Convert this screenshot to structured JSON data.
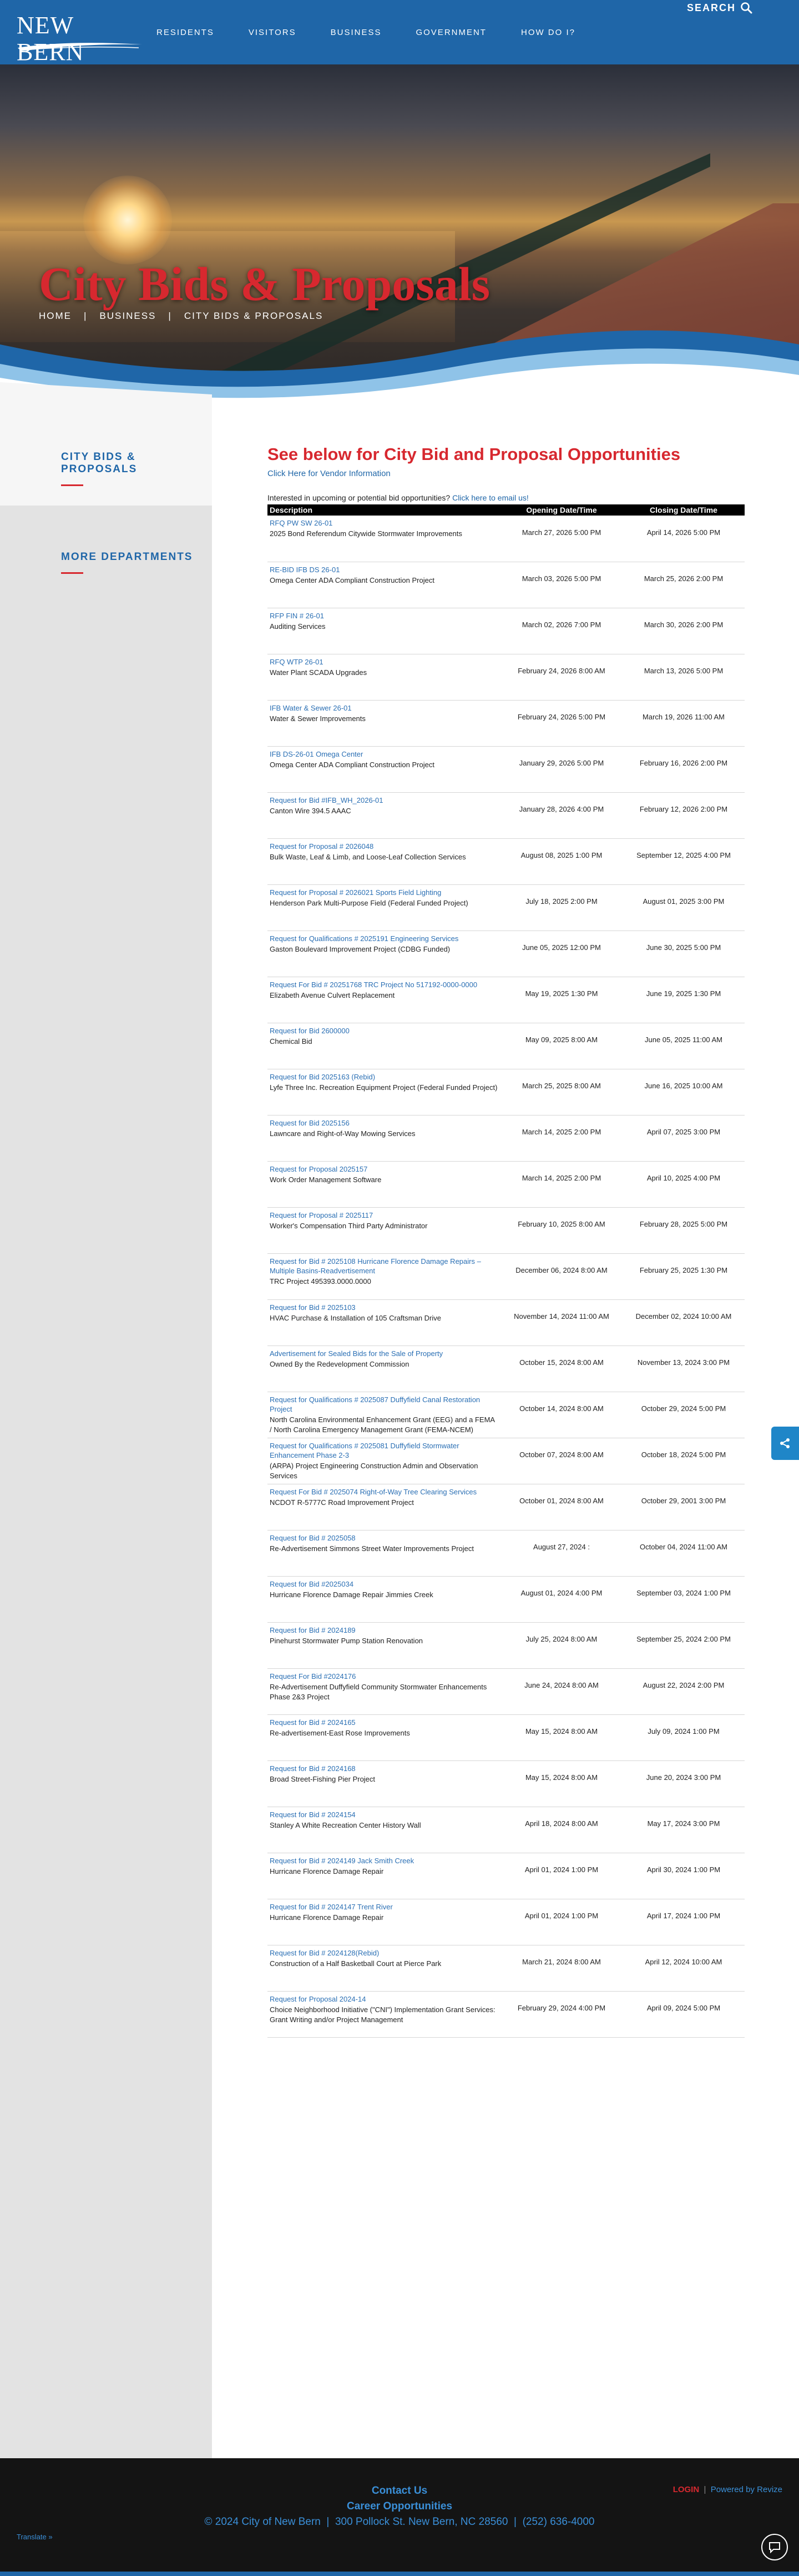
{
  "header": {
    "logo_text": "NEW BERN",
    "nav": [
      "RESIDENTS",
      "VISITORS",
      "BUSINESS",
      "GOVERNMENT",
      "HOW DO I?"
    ],
    "search_label": "SEARCH"
  },
  "hero": {
    "title": "City Bids & Proposals",
    "breadcrumb": [
      "HOME",
      "BUSINESS",
      "CITY BIDS & PROPOSALS"
    ]
  },
  "sidebar": {
    "current": "CITY BIDS & PROPOSALS",
    "more": "MORE DEPARTMENTS"
  },
  "main": {
    "heading": "See below for City Bid and Proposal Opportunities",
    "vendor_link": "Click Here for Vendor Information",
    "interest_text": "Interested in upcoming or potential bid opportunities?",
    "interest_link": "Click here to email us!",
    "columns": [
      "Description",
      "Opening Date/Time",
      "Closing Date/Time"
    ],
    "bids": [
      {
        "link": "RFQ PW SW 26-01",
        "desc": "2025 Bond Referendum Citywide Stormwater Improvements",
        "open": "March 27, 2026 5:00 PM",
        "close": "April 14, 2026 5:00 PM"
      },
      {
        "link": "RE-BID IFB DS 26-01",
        "desc": "Omega Center ADA Compliant Construction Project",
        "open": "March 03, 2026 5:00 PM",
        "close": "March 25, 2026 2:00 PM"
      },
      {
        "link": "RFP FIN # 26-01",
        "desc": "Auditing Services",
        "open": "March 02, 2026 7:00 PM",
        "close": "March 30, 2026 2:00 PM"
      },
      {
        "link": "RFQ WTP 26-01",
        "desc": "Water Plant SCADA Upgrades",
        "open": "February 24, 2026 8:00 AM",
        "close": "March 13, 2026 5:00 PM"
      },
      {
        "link": "IFB Water & Sewer 26-01",
        "desc": "Water & Sewer Improvements",
        "open": "February 24, 2026 5:00 PM",
        "close": "March 19, 2026 11:00 AM"
      },
      {
        "link": "IFB DS-26-01 Omega Center",
        "desc": "Omega Center ADA Compliant Construction Project",
        "open": "January 29, 2026 5:00 PM",
        "close": "February 16, 2026 2:00 PM"
      },
      {
        "link": "Request for Bid #IFB_WH_2026-01",
        "desc": "Canton Wire 394.5 AAAC",
        "open": "January 28, 2026 4:00 PM",
        "close": "February 12, 2026 2:00 PM"
      },
      {
        "link": "Request for Proposal  # 2026048",
        "desc": "Bulk Waste, Leaf & Limb, and Loose-Leaf Collection Services",
        "open": "August 08, 2025 1:00 PM",
        "close": "September 12, 2025 4:00 PM"
      },
      {
        "link": "Request for Proposal  # 2026021 Sports Field Lighting",
        "desc": "Henderson Park Multi-Purpose Field (Federal Funded Project)",
        "open": "July 18, 2025 2:00 PM",
        "close": "August 01, 2025 3:00 PM"
      },
      {
        "link": "Request for Qualifications # 2025191 Engineering Services",
        "desc": "Gaston Boulevard Improvement Project (CDBG Funded)",
        "open": "June 05, 2025 12:00 PM",
        "close": "June 30, 2025 5:00 PM"
      },
      {
        "link": "Request For Bid # 20251768 TRC Project No 517192-0000-0000",
        "desc": "Elizabeth Avenue Culvert Replacement",
        "open": "May 19, 2025 1:30 PM",
        "close": "June 19, 2025 1:30 PM"
      },
      {
        "link": "Request for Bid 2600000",
        "desc": "Chemical Bid",
        "open": "May 09, 2025 8:00 AM",
        "close": "June 05, 2025 11:00 AM"
      },
      {
        "link": "Request for Bid 2025163 (Rebid)",
        "desc": "Lyfe Three Inc. Recreation Equipment Project (Federal Funded Project)",
        "open": "March 25, 2025 8:00 AM",
        "close": "June 16, 2025 10:00 AM"
      },
      {
        "link": "Request for Bid 2025156",
        "desc": "Lawncare and Right-of-Way Mowing Services",
        "open": "March 14, 2025 2:00 PM",
        "close": "April 07, 2025 3:00 PM"
      },
      {
        "link": "Request for Proposal 2025157",
        "desc": "Work Order Management Software",
        "open": "March 14, 2025 2:00 PM",
        "close": "April 10, 2025 4:00 PM"
      },
      {
        "link": "Request for Proposal # 2025117",
        "desc": "Worker's Compensation Third Party Administrator",
        "open": "February 10, 2025 8:00 AM",
        "close": "February 28, 2025 5:00 PM"
      },
      {
        "link": "Request for Bid # 2025108 Hurricane Florence Damage Repairs – Multiple Basins-Readvertisement",
        "desc": "TRC Project 495393.0000.0000",
        "open": "December 06, 2024 8:00 AM",
        "close": "February 25, 2025 1:30 PM"
      },
      {
        "link": "Request for Bid # 2025103",
        "desc": "HVAC Purchase & Installation of 105 Craftsman Drive",
        "open": "November 14, 2024 11:00 AM",
        "close": "December 02, 2024 10:00 AM"
      },
      {
        "link": "Advertisement for Sealed Bids for the Sale of Property",
        "desc": "Owned By the Redevelopment Commission",
        "open": "October 15, 2024 8:00 AM",
        "close": "November 13, 2024 3:00 PM"
      },
      {
        "link": "Request for Qualifications # 2025087 Duffyfield Canal Restoration Project",
        "desc": "North Carolina Environmental Enhancement Grant (EEG) and a FEMA / North Carolina Emergency Management Grant (FEMA-NCEM)",
        "open": "October 14, 2024 8:00 AM",
        "close": "October 29, 2024 5:00 PM"
      },
      {
        "link": "Request for Qualifications # 2025081 Duffyfield Stormwater Enhancement Phase 2-3",
        "desc": "(ARPA) Project Engineering Construction Admin and Observation Services",
        "open": "October 07, 2024 8:00 AM",
        "close": "October 18, 2024 5:00 PM"
      },
      {
        "link": "Request For Bid # 2025074 Right-of-Way Tree Clearing Services",
        "desc": "NCDOT R-5777C Road Improvement Project",
        "open": "October 01, 2024 8:00 AM",
        "close": "October 29, 2001 3:00 PM"
      },
      {
        "link": "Request for Bid # 2025058",
        "desc": "Re-Advertisement Simmons Street Water Improvements Project",
        "open": "August 27, 2024 :",
        "close": "October 04, 2024 11:00 AM"
      },
      {
        "link": "Request for Bid #2025034",
        "desc": "Hurricane Florence Damage Repair Jimmies Creek",
        "open": "August 01, 2024 4:00 PM",
        "close": "September 03, 2024 1:00 PM"
      },
      {
        "link": "Request for Bid # 2024189",
        "desc": "Pinehurst Stormwater Pump Station Renovation",
        "open": "July 25, 2024 8:00 AM",
        "close": "September 25, 2024 2:00 PM"
      },
      {
        "link": "Request For Bid #2024176",
        "desc": "Re-Advertisement Duffyfield Community Stormwater Enhancements Phase 2&3 Project",
        "open": "June 24, 2024 8:00 AM",
        "close": "August 22, 2024 2:00 PM"
      },
      {
        "link": "Request for Bid # 2024165",
        "desc": "Re-advertisement-East Rose Improvements",
        "open": "May 15, 2024 8:00 AM",
        "close": "July 09, 2024 1:00 PM"
      },
      {
        "link": "Request for Bid # 2024168",
        "desc": "Broad Street-Fishing Pier Project",
        "open": "May 15, 2024 8:00 AM",
        "close": "June 20, 2024 3:00 PM"
      },
      {
        "link": "Request for Bid # 2024154",
        "desc": "Stanley A White Recreation Center History Wall",
        "open": "April 18, 2024 8:00 AM",
        "close": "May 17, 2024 3:00 PM"
      },
      {
        "link": "Request for Bid # 2024149 Jack Smith Creek",
        "desc": "Hurricane Florence Damage Repair",
        "open": "April 01, 2024 1:00 PM",
        "close": "April 30, 2024 1:00 PM"
      },
      {
        "link": "Request for Bid # 2024147 Trent River",
        "desc": "Hurricane Florence  Damage Repair",
        "open": "April 01, 2024 1:00 PM",
        "close": "April 17, 2024 1:00 PM"
      },
      {
        "link": "Request for Bid # 2024128(Rebid)",
        "desc": "Construction of a Half Basketball Court at Pierce Park",
        "open": "March 21, 2024 8:00 AM",
        "close": "April 12, 2024 10:00 AM"
      },
      {
        "link": "Request for Proposal  2024-14",
        "desc": "Choice Neighborhood Initiative (\"CNI\") Implementation Grant Services: Grant Writing and/or Project Management",
        "open": "February 29, 2024 4:00 PM",
        "close": "April 09, 2024 5:00 PM"
      }
    ]
  },
  "footer": {
    "contact": "Contact Us",
    "careers": "Career Opportunities",
    "copyright": "© 2024 City of New Bern",
    "address": "300 Pollock St. New Bern, NC 28560",
    "phone": "(252) 636-4000",
    "login": "LOGIN",
    "powered": "Powered by Revize",
    "translate": "Translate »"
  }
}
